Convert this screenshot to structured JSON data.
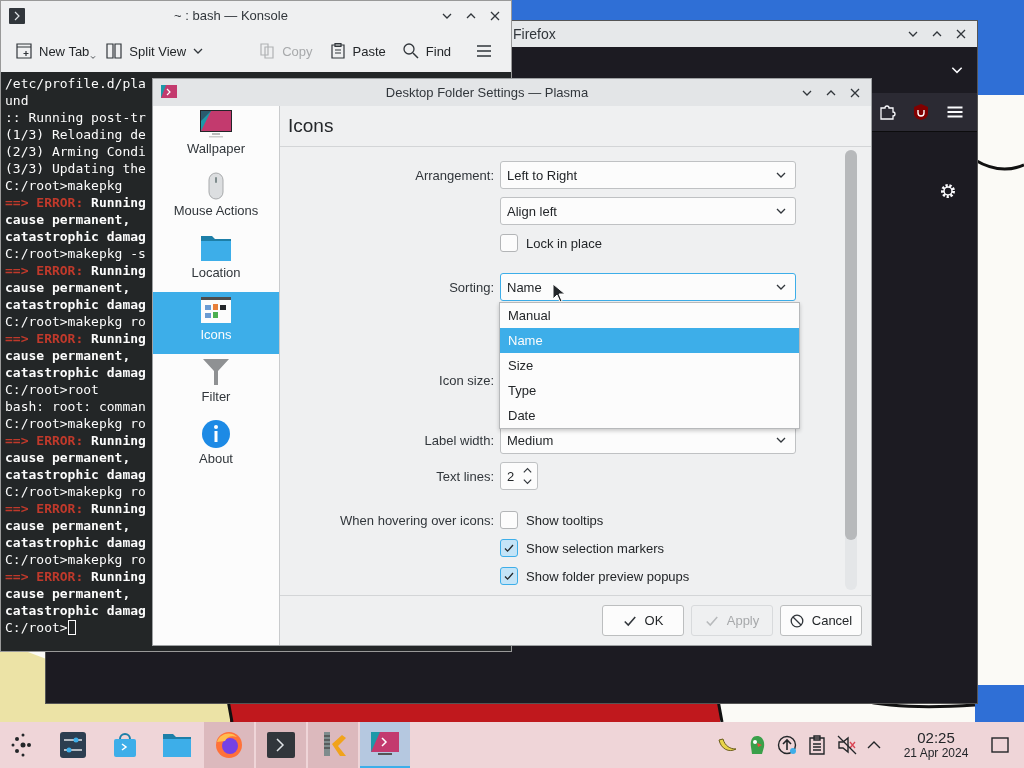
{
  "konsole": {
    "title": "~ : bash — Konsole",
    "toolbar": [
      {
        "kind": "new-tab",
        "label": "New Tab",
        "disabled": false
      },
      {
        "kind": "split",
        "label": "Split View",
        "disabled": false
      },
      {
        "kind": "copy",
        "label": "Copy",
        "disabled": true
      },
      {
        "kind": "paste",
        "label": "Paste",
        "disabled": false
      },
      {
        "kind": "find",
        "label": "Find",
        "disabled": false
      },
      {
        "kind": "menu",
        "disabled": false
      }
    ],
    "lines": [
      {
        "kind": "plain",
        "text": "/etc/profile.d/pla"
      },
      {
        "kind": "plain",
        "text": "und"
      },
      {
        "kind": "plain",
        "text": ":: Running post-tr"
      },
      {
        "kind": "plain",
        "text": "(1/3) Reloading de"
      },
      {
        "kind": "plain",
        "text": "(2/3) Arming Condi"
      },
      {
        "kind": "plain",
        "text": "(3/3) Updating the"
      },
      {
        "kind": "plain",
        "text": "C:/root>makepkg"
      },
      {
        "kind": "error",
        "marker": "==> ERROR:",
        "text": "Running"
      },
      {
        "kind": "bold",
        "text": "cause permanent,"
      },
      {
        "kind": "bold",
        "text": "catastrophic damag"
      },
      {
        "kind": "plain",
        "text": "C:/root>makepkg -s"
      },
      {
        "kind": "error",
        "marker": "==> ERROR:",
        "text": "Running"
      },
      {
        "kind": "bold",
        "text": "cause permanent,"
      },
      {
        "kind": "bold",
        "text": "catastrophic damag"
      },
      {
        "kind": "plain",
        "text": "C:/root>makepkg ro"
      },
      {
        "kind": "error",
        "marker": "==> ERROR:",
        "text": "Running"
      },
      {
        "kind": "bold",
        "text": "cause permanent,"
      },
      {
        "kind": "bold",
        "text": "catastrophic damag"
      },
      {
        "kind": "plain",
        "text": "C:/root>root"
      },
      {
        "kind": "plain",
        "text": "bash: root: comman"
      },
      {
        "kind": "plain",
        "text": "C:/root>makepkg ro"
      },
      {
        "kind": "error",
        "marker": "==> ERROR:",
        "text": "Running"
      },
      {
        "kind": "bold",
        "text": "cause permanent,"
      },
      {
        "kind": "bold",
        "text": "catastrophic damag"
      },
      {
        "kind": "plain",
        "text": "C:/root>makepkg ro"
      },
      {
        "kind": "error",
        "marker": "==> ERROR:",
        "text": "Running"
      },
      {
        "kind": "bold",
        "text": "cause permanent,"
      },
      {
        "kind": "bold",
        "text": "catastrophic damag"
      },
      {
        "kind": "plain",
        "text": "C:/root>makepkg ro"
      },
      {
        "kind": "error",
        "marker": "==> ERROR:",
        "text": "Running"
      },
      {
        "kind": "bold",
        "text": "cause permanent,"
      },
      {
        "kind": "bold",
        "text": "catastrophic damag"
      },
      {
        "kind": "cursor",
        "text": "C:/root>"
      }
    ]
  },
  "firefox": {
    "title": "Firefox"
  },
  "dialog": {
    "title": "Desktop Folder Settings — Plasma",
    "sidebar": [
      {
        "kind": "wallpaper",
        "label": "Wallpaper",
        "selected": false
      },
      {
        "kind": "mouse",
        "label": "Mouse Actions",
        "selected": false
      },
      {
        "kind": "location",
        "label": "Location",
        "selected": false
      },
      {
        "kind": "icons",
        "label": "Icons",
        "selected": true
      },
      {
        "kind": "filter",
        "label": "Filter",
        "selected": false
      },
      {
        "kind": "about",
        "label": "About",
        "selected": false
      }
    ],
    "heading": "Icons",
    "groups": [
      [
        {
          "kind": "combo",
          "label": "Arrangement:",
          "value": "Left to Right",
          "expanded": false
        },
        {
          "kind": "combo",
          "value": "Align left",
          "expanded": false
        },
        {
          "kind": "checkbox",
          "text": "Lock in place",
          "checked": false
        }
      ],
      [
        {
          "kind": "combo",
          "label": "Sorting:",
          "value": "Name",
          "expanded": true,
          "options": [
            {
              "text": "Manual",
              "selected": false
            },
            {
              "text": "Name",
              "selected": true
            },
            {
              "text": "Size",
              "selected": false
            },
            {
              "text": "Type",
              "selected": false
            },
            {
              "text": "Date",
              "selected": false
            }
          ]
        }
      ],
      [
        {
          "kind": "slider",
          "label": "Icon size:"
        },
        {
          "kind": "combo",
          "label": "Label width:",
          "value": "Medium",
          "expanded": false
        },
        {
          "kind": "spin",
          "label": "Text lines:",
          "value": "2"
        }
      ],
      [
        {
          "kind": "checkbox",
          "label": "When hovering over icons:",
          "text": "Show tooltips",
          "checked": false
        },
        {
          "kind": "checkbox",
          "text": "Show selection markers",
          "checked": true
        },
        {
          "kind": "checkbox",
          "text": "Show folder preview popups",
          "checked": true
        }
      ]
    ],
    "buttons": [
      {
        "kind": "ok",
        "label": "OK",
        "disabled": false
      },
      {
        "kind": "apply",
        "label": "Apply",
        "disabled": true
      },
      {
        "kind": "cancel",
        "label": "Cancel",
        "disabled": false
      }
    ]
  },
  "taskbar": {
    "tasks": [
      {
        "kind": "launcher",
        "open": false,
        "selected": false
      },
      {
        "kind": "settings",
        "open": false,
        "selected": false
      },
      {
        "kind": "store",
        "open": false,
        "selected": false
      },
      {
        "kind": "files",
        "open": false,
        "selected": false
      },
      {
        "kind": "browser",
        "open": true,
        "selected": false
      },
      {
        "kind": "terminal",
        "open": true,
        "selected": false
      },
      {
        "kind": "archiver",
        "open": true,
        "selected": false
      },
      {
        "kind": "desktop-settings",
        "open": true,
        "selected": true
      }
    ],
    "tray": [
      {
        "kind": "banana"
      },
      {
        "kind": "parrot"
      },
      {
        "kind": "update"
      },
      {
        "kind": "clipboard"
      },
      {
        "kind": "mute"
      },
      {
        "kind": "expand"
      }
    ],
    "clock": {
      "time": "02:25",
      "date": "21 Apr 2024"
    }
  }
}
